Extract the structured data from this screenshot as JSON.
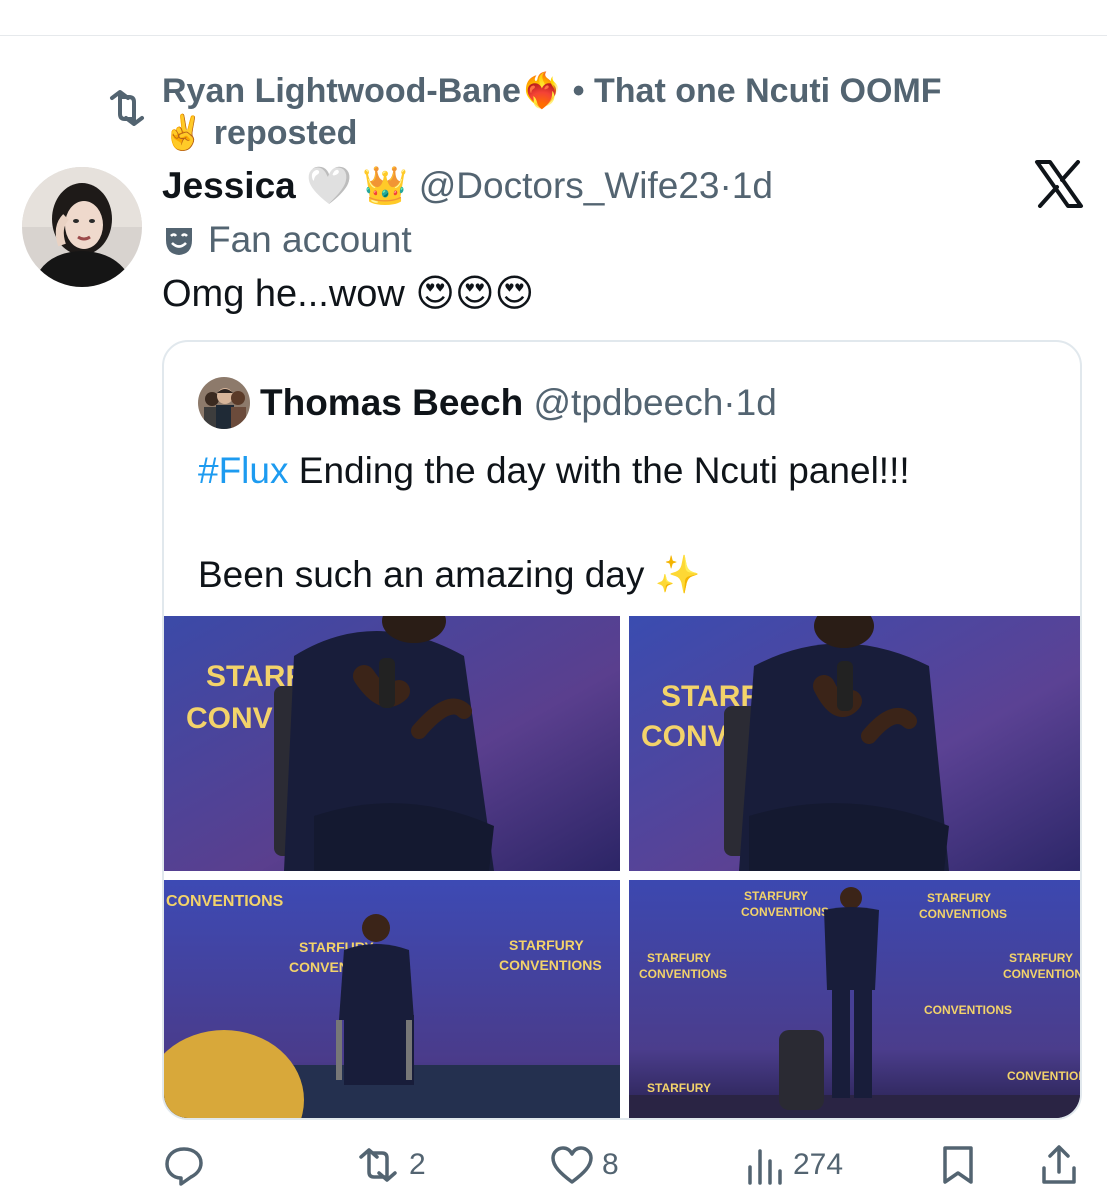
{
  "repost": {
    "reposter": "Ryan Lightwood-Bane❤️‍🔥 • That one Ncuti OOMF",
    "reposter_emoji": "✌️",
    "label": "reposted"
  },
  "tweet": {
    "author_name": "Jessica",
    "author_badges": "🤍 👑",
    "author_handle": "@Doctors_Wife23",
    "separator": "·",
    "time": "1d",
    "fan_label": "Fan account",
    "text": "Omg he...wow 😍😍😍"
  },
  "quote": {
    "author_name": "Thomas Beech",
    "author_handle": "@tpdbeech",
    "separator": "·",
    "time": "1d",
    "hashtag": "#Flux",
    "line1": " Ending the day with the Ncuti panel!!!",
    "line2": "Been such an amazing day ✨",
    "photo_banner_1": "STARFURY",
    "photo_banner_2": "CONVENTIONS"
  },
  "actions": {
    "replies": "",
    "reposts": "2",
    "likes": "8",
    "views": "274"
  },
  "colors": {
    "text": "#0f1419",
    "muted": "#536471",
    "link": "#1d9bf0",
    "border": "#e1e8ed"
  },
  "icons": [
    "repost-icon",
    "x-logo-icon",
    "theater-masks-icon",
    "reply-icon",
    "like-icon",
    "views-icon",
    "bookmark-icon",
    "share-icon"
  ]
}
